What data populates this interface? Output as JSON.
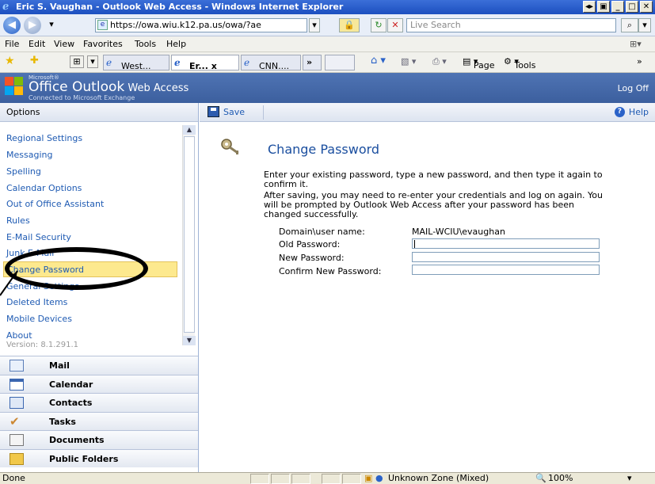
{
  "window": {
    "title": "Eric S. Vaughan - Outlook Web Access - Windows Internet Explorer",
    "address": "https://owa.wiu.k12.pa.us/owa/?ae",
    "search_placeholder": "Live Search"
  },
  "menu": [
    "File",
    "Edit",
    "View",
    "Favorites",
    "Tools",
    "Help"
  ],
  "tabs": [
    {
      "label": "West..."
    },
    {
      "label": "Er... x"
    },
    {
      "label": "CNN...."
    }
  ],
  "toolbar_right": {
    "page": "Page",
    "tools": "Tools"
  },
  "owa": {
    "brand_small": "Microsoft®",
    "brand_main": "Office Outlook",
    "brand_tail": " Web Access",
    "brand_sub": "Connected to Microsoft Exchange",
    "logoff": "Log Off"
  },
  "sidebar": {
    "header": "Options",
    "items": [
      {
        "label": "Regional Settings"
      },
      {
        "label": "Messaging"
      },
      {
        "label": "Spelling"
      },
      {
        "label": "Calendar Options"
      },
      {
        "label": "Out of Office Assistant"
      },
      {
        "label": "Rules"
      },
      {
        "label": "E-Mail Security"
      },
      {
        "label": "Junk E-Mail"
      },
      {
        "label": "Change Password"
      },
      {
        "label": "General Settings"
      },
      {
        "label": "Deleted Items"
      },
      {
        "label": "Mobile Devices"
      },
      {
        "label": "About"
      }
    ],
    "selected_index": 8,
    "version": "Version: 8.1.291.1",
    "modules": [
      {
        "label": "Mail"
      },
      {
        "label": "Calendar"
      },
      {
        "label": "Contacts"
      },
      {
        "label": "Tasks"
      },
      {
        "label": "Documents"
      },
      {
        "label": "Public Folders"
      }
    ]
  },
  "main": {
    "save_label": "Save",
    "help_label": "Help",
    "title": "Change Password",
    "para1": "Enter your existing password, type a new password, and then type it again to confirm it.",
    "para2": "After saving, you may need to re-enter your credentials and log on again. You will be prompted by Outlook Web Access after your password has been changed successfully.",
    "fields": {
      "domain_label": "Domain\\user name:",
      "domain_value": "MAIL-WCIU\\evaughan",
      "old_label": "Old Password:",
      "old_value": "",
      "new_label": "New Password:",
      "new_value": "",
      "confirm_label": "Confirm New Password:",
      "confirm_value": ""
    }
  },
  "status": {
    "left": "Done",
    "zone": "Unknown Zone (Mixed)",
    "zoom": "100%"
  }
}
